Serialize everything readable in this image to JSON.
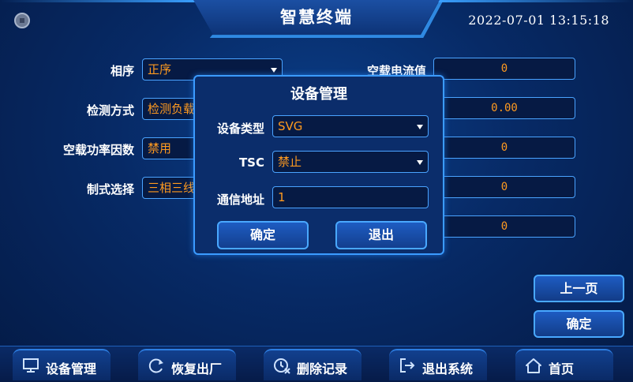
{
  "header": {
    "title": "智慧终端",
    "datetime": "2022-07-01  13:15:18"
  },
  "form": {
    "left": [
      {
        "label": "相序",
        "value": "正序",
        "dropdown": true
      },
      {
        "label": "检测方式",
        "value": "检测负载",
        "dropdown": false
      },
      {
        "label": "空载功率因数",
        "value": "禁用",
        "dropdown": false
      },
      {
        "label": "制式选择",
        "value": "三相三线",
        "dropdown": false
      }
    ],
    "right": [
      {
        "label": "空载电流值",
        "value": "0"
      },
      {
        "value": "0.00"
      },
      {
        "value": "0"
      },
      {
        "value": "0"
      },
      {
        "value": "0"
      }
    ]
  },
  "dialog": {
    "title": "设备管理",
    "fields": [
      {
        "label": "设备类型",
        "value": "SVG"
      },
      {
        "label": "TSC",
        "value": "禁止"
      },
      {
        "label": "通信地址",
        "value": "1"
      }
    ],
    "ok_label": "确定",
    "exit_label": "退出"
  },
  "side_buttons": {
    "prev_label": "上一页",
    "confirm_label": "确定"
  },
  "nav": [
    {
      "label": "设备管理",
      "icon": "monitor-icon"
    },
    {
      "label": "恢复出厂",
      "icon": "refresh-icon"
    },
    {
      "label": "删除记录",
      "icon": "clock-delete-icon"
    },
    {
      "label": "退出系统",
      "icon": "exit-icon"
    },
    {
      "label": "首页",
      "icon": "home-icon"
    }
  ],
  "colors": {
    "accent": "#3b9bff",
    "value_text": "#ff9a1f",
    "background": "#072a66"
  }
}
